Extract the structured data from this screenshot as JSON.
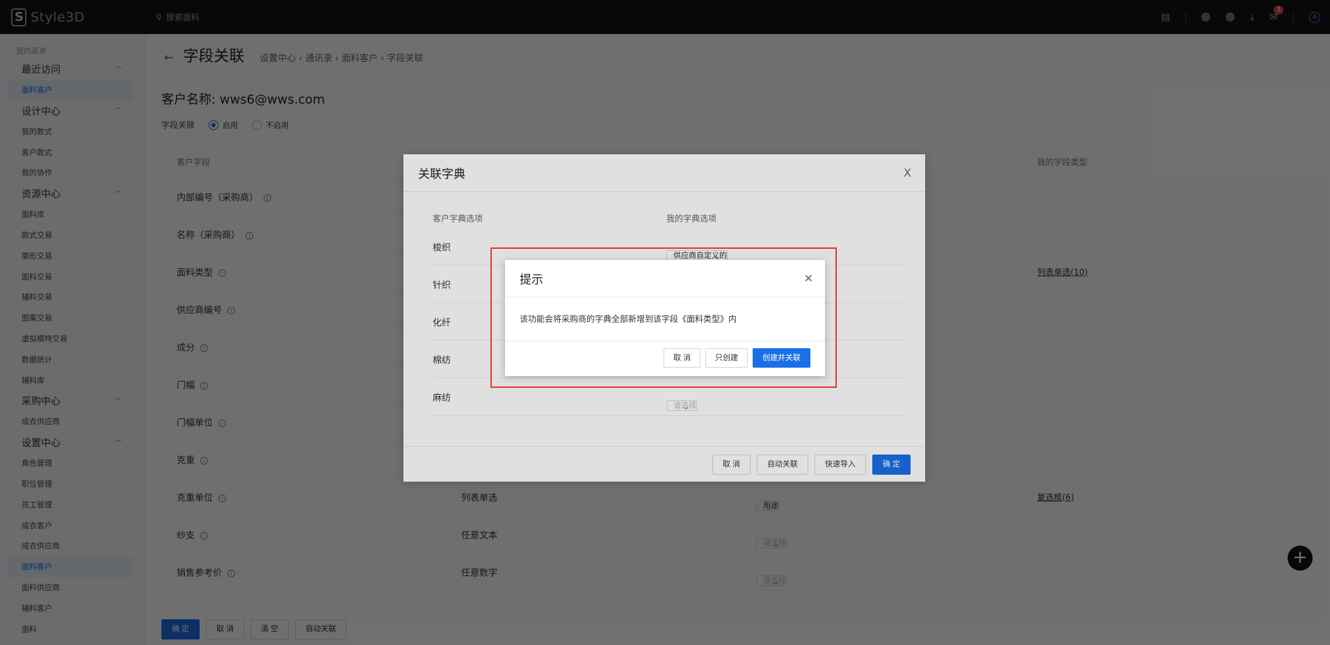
{
  "topbar": {
    "brand": "Style3D",
    "search_placeholder": "搜索面料",
    "notification_count": "3",
    "avatar_letter": "A"
  },
  "sidebar": {
    "caption": "我的菜单",
    "groups": [
      {
        "label": "最近访问",
        "items": [
          "面料客户"
        ]
      },
      {
        "label": "设计中心",
        "items": [
          "我的款式",
          "客户款式",
          "我的协作"
        ]
      },
      {
        "label": "资源中心",
        "items": [
          "面料库",
          "款式交易",
          "廓形交易",
          "面料交易",
          "辅料交易",
          "图案交易",
          "虚拟模特交易",
          "数据统计",
          "辅料库"
        ]
      },
      {
        "label": "采购中心",
        "items": [
          "成衣供应商"
        ]
      },
      {
        "label": "设置中心",
        "items": [
          "角色管理",
          "职位管理",
          "员工管理",
          "成衣客户",
          "成衣供应商",
          "面料客户",
          "面料供应商",
          "辅料客户",
          "面料"
        ]
      }
    ]
  },
  "page": {
    "back": "←",
    "title": "字段关联",
    "breadcrumb": [
      "设置中心",
      "通讯录",
      "面料客户",
      "字段关联"
    ],
    "customer_name": "客户名称: wws6@wws.com",
    "link_label": "字段关联",
    "radio_on": "启用",
    "radio_off": "不启用"
  },
  "table": {
    "headers": [
      "客户字段",
      "",
      "",
      "我的字段类型"
    ],
    "rows": [
      {
        "field": "内部编号（采购商）",
        "type": "",
        "select": "",
        "my_type": ""
      },
      {
        "field": "名称（采购商）",
        "type": "",
        "select": "",
        "my_type": ""
      },
      {
        "field": "面料类型",
        "type": "",
        "select": "",
        "my_type": "列表单选(10)"
      },
      {
        "field": "供应商编号",
        "type": "",
        "select": "",
        "my_type": ""
      },
      {
        "field": "成分",
        "type": "",
        "select": "",
        "my_type": ""
      },
      {
        "field": "门幅",
        "type": "",
        "select": "",
        "my_type": ""
      },
      {
        "field": "门幅单位",
        "type": "",
        "select": "",
        "my_type": ""
      },
      {
        "field": "克重",
        "type": "",
        "select": "",
        "my_type": ""
      },
      {
        "field": "克重单位",
        "type": "列表单选",
        "select": "用途",
        "my_type": "复选框(6)"
      },
      {
        "field": "纱支",
        "type": "任意文本",
        "select": "请选择",
        "my_type": ""
      },
      {
        "field": "销售参考价",
        "type": "任意数字",
        "select": "请选择",
        "my_type": ""
      }
    ]
  },
  "bottom_buttons": [
    "确 定",
    "取 消",
    "清 空",
    "自动关联"
  ],
  "fab": "+",
  "dialog_dict": {
    "title": "关联字典",
    "col_customer": "客户字典选项",
    "col_mine": "我的字典选项",
    "rows": [
      {
        "option": "梭织",
        "select": "供应商自定义的"
      },
      {
        "option": "针织",
        "select": ""
      },
      {
        "option": "化纤",
        "select": ""
      },
      {
        "option": "棉纺",
        "select": ""
      },
      {
        "option": "麻纺",
        "select": "请选择"
      }
    ],
    "buttons": [
      "取 消",
      "自动关联",
      "快速导入",
      "确 定"
    ]
  },
  "dialog_tip": {
    "title": "提示",
    "message": "该功能会将采购商的字典全部新增到该字段《面料类型》内",
    "buttons": [
      "取 消",
      "只创建",
      "创建并关联"
    ]
  },
  "colors": {
    "primary": "#1a6fe8",
    "highlight": "#e53935",
    "topbar": "#141414"
  }
}
